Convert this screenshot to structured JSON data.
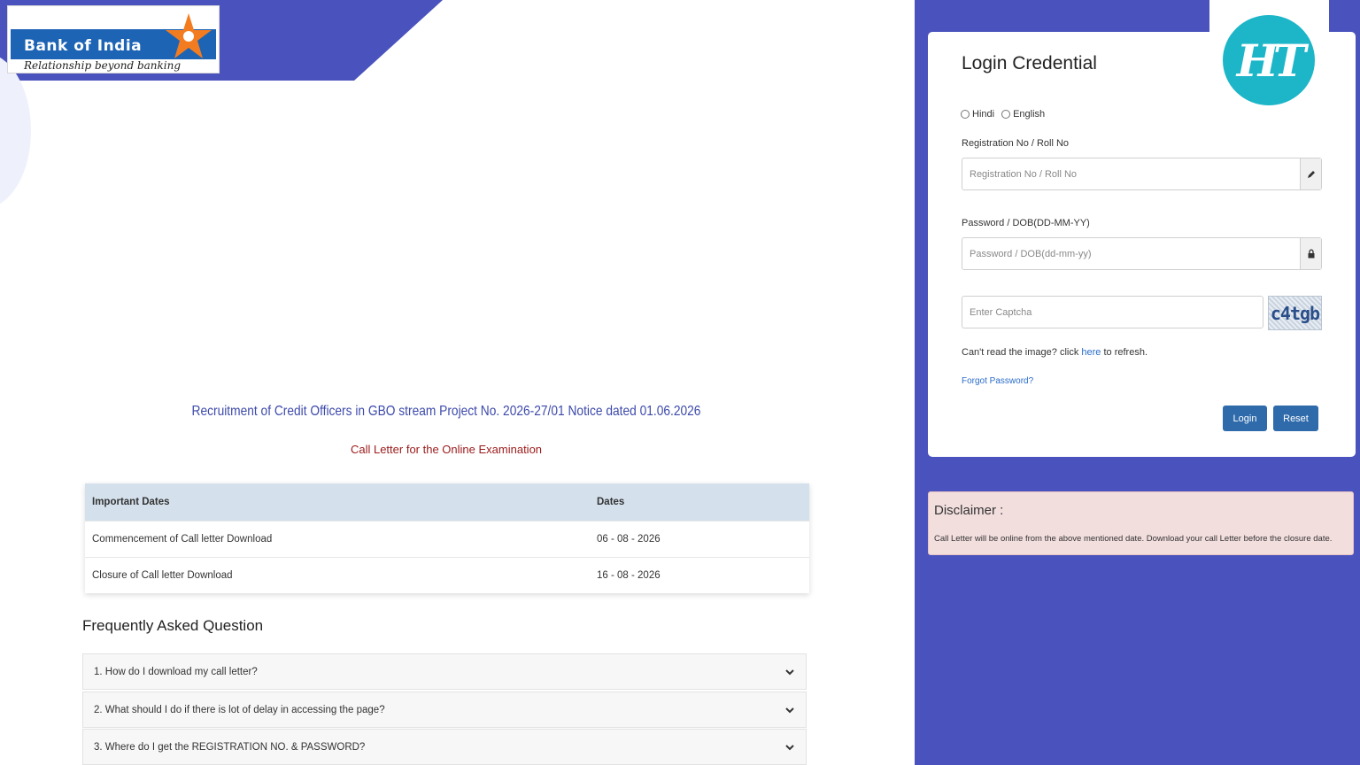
{
  "brand": {
    "name": "Bank of India",
    "tagline": "Relationship beyond banking"
  },
  "notice": {
    "title": "Recruitment of Credit Officers in GBO stream Project No. 2026-27/01 Notice dated 01.06.2026",
    "subtitle": "Call Letter for the Online Examination"
  },
  "dates_table": {
    "headers": [
      "Important Dates",
      "Dates"
    ],
    "rows": [
      {
        "event": "Commencement of Call letter Download",
        "date": "06 - 08 - 2026"
      },
      {
        "event": "Closure of Call letter Download",
        "date": "16 - 08 - 2026"
      }
    ]
  },
  "faq": {
    "heading": "Frequently Asked Question",
    "items": [
      {
        "question": "1. How do I download my call letter?"
      },
      {
        "question": "2. What should I do if there is lot of delay in accessing the page?"
      },
      {
        "question": "3. Where do I get the REGISTRATION NO. & PASSWORD?"
      }
    ]
  },
  "login": {
    "title": "Login Credential",
    "languages": [
      "Hindi",
      "English"
    ],
    "registration_label": "Registration No / Roll No",
    "registration_placeholder": "Registration No / Roll No",
    "password_label": "Password / DOB(DD-MM-YY)",
    "password_placeholder": "Password / DOB(dd-mm-yy)",
    "captcha_placeholder": "Enter Captcha",
    "captcha_text": "c4tgb",
    "refresh_prefix": "Can't read the image? click ",
    "refresh_link": "here",
    "refresh_suffix": " to refresh.",
    "forgot_password": "Forgot Password?",
    "login_button": "Login",
    "reset_button": "Reset"
  },
  "disclaimer": {
    "title": "Disclaimer :",
    "text": "Call Letter will be online from the above mentioned date. Download your call Letter before the closure date."
  },
  "watermark": {
    "text": "HT"
  },
  "colors": {
    "brand_blue": "#4a52bd",
    "title_blue": "#3d4aab",
    "subtitle_red": "#9b1a1a",
    "button_blue": "#2f6bab",
    "ht_teal": "#1cb6c8",
    "disclaimer_bg": "#f3dede"
  }
}
